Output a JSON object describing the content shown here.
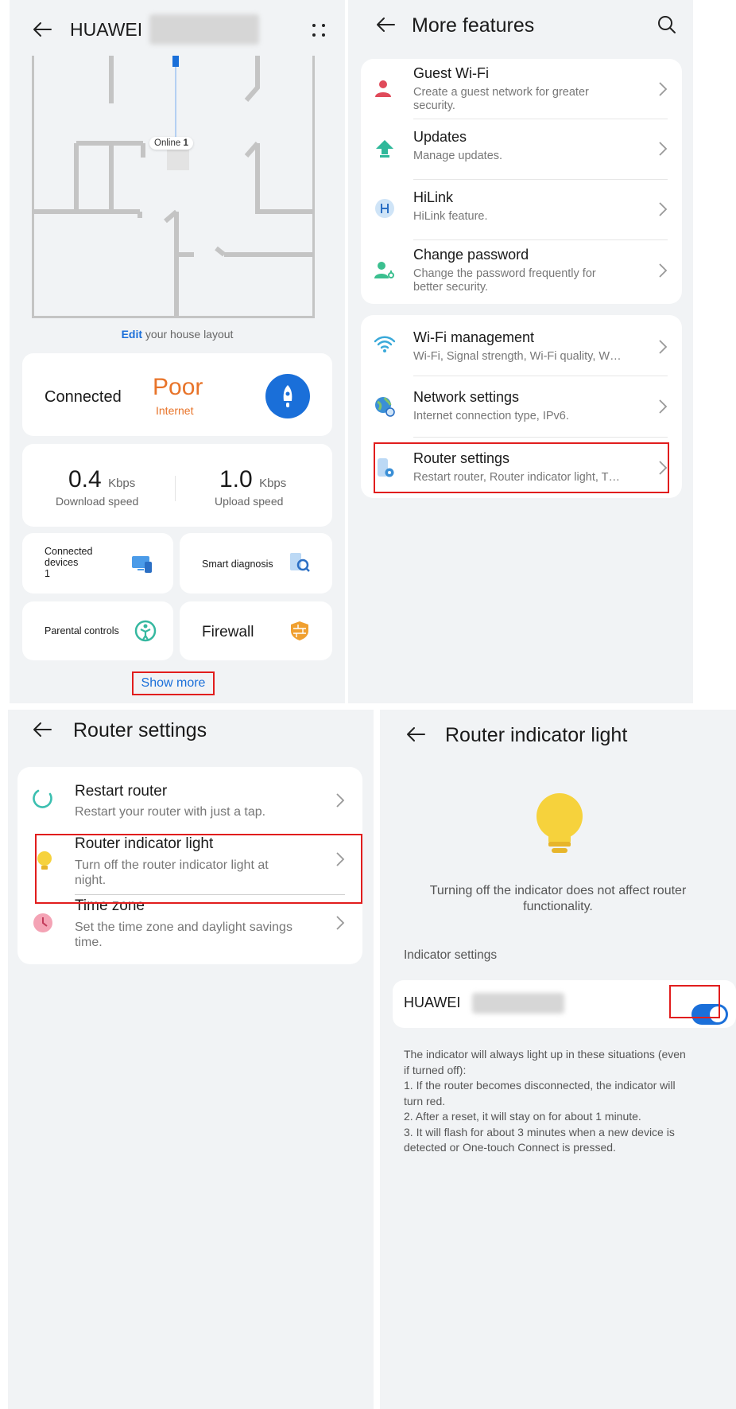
{
  "panel1": {
    "title": "HUAWEI",
    "online_label": "Online",
    "online_count": "1",
    "edit_link": "Edit",
    "edit_rest": " your house layout",
    "status": {
      "connection": "Connected",
      "quality": "Poor",
      "quality_sub": "Internet"
    },
    "download": {
      "value": "0.4",
      "unit": "Kbps",
      "label": "Download speed"
    },
    "upload": {
      "value": "1.0",
      "unit": "Kbps",
      "label": "Upload speed"
    },
    "tiles": {
      "connected_devices": {
        "label_line1": "Connected",
        "label_line2": "devices",
        "count": "1"
      },
      "smart_diagnosis": "Smart diagnosis",
      "parental_controls": "Parental controls",
      "firewall": "Firewall"
    },
    "show_more": "Show more"
  },
  "panel2": {
    "title": "More features",
    "group1": [
      {
        "icon": "person-icon",
        "title": "Guest Wi-Fi",
        "sub_l1": "Create a guest network for greater",
        "sub_l2": "security."
      },
      {
        "icon": "update-arrow-icon",
        "title": "Updates",
        "sub_l1": "Manage updates.",
        "sub_l2": ""
      },
      {
        "icon": "hilink-icon",
        "title": "HiLink",
        "sub_l1": "HiLink feature.",
        "sub_l2": ""
      },
      {
        "icon": "key-person-icon",
        "title": "Change password",
        "sub_l1": "Change the password frequently for",
        "sub_l2": "better security."
      }
    ],
    "group2": [
      {
        "icon": "wifi-icon",
        "title": "Wi-Fi management",
        "sub_l1": "Wi-Fi, Signal strength, Wi-Fi quality, W…"
      },
      {
        "icon": "globe-gear-icon",
        "title": "Network settings",
        "sub_l1": "Internet connection type, IPv6."
      },
      {
        "icon": "router-gear-icon",
        "title": "Router settings",
        "sub_l1": "Restart router, Router indicator light, T…"
      }
    ]
  },
  "panel3": {
    "title": "Router settings",
    "items": [
      {
        "icon": "restart-icon",
        "title": "Restart router",
        "sub_l1": "Restart your router with just a tap.",
        "sub_l2": ""
      },
      {
        "icon": "bulb-icon",
        "title": "Router indicator light",
        "sub_l1": "Turn off the router indicator light at",
        "sub_l2": "night."
      },
      {
        "icon": "clock-icon",
        "title": "Time zone",
        "sub_l1": "Set the time zone and daylight savings",
        "sub_l2": "time."
      }
    ]
  },
  "panel4": {
    "title": "Router indicator light",
    "desc_l1": "Turning off the indicator does not affect router",
    "desc_l2": "functionality.",
    "section_label": "Indicator settings",
    "device_name": "HUAWEI",
    "toggle_on": true,
    "notes": "The indicator will always light up in these situations (even\nif turned off):\n1. If the router becomes disconnected, the indicator will\nturn red.\n2. After a reset, it will stay on for about 1 minute.\n3. It will flash for about 3 minutes when a new device is\ndetected or One-touch Connect is pressed."
  },
  "colors": {
    "accent": "#1a6fd9",
    "poor": "#e8742a",
    "highlight": "#e11d1d",
    "bulb": "#f6d23c"
  }
}
